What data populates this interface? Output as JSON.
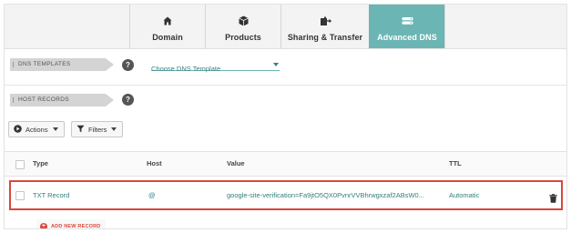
{
  "tabs": [
    {
      "label": "Domain",
      "icon": "home-icon"
    },
    {
      "label": "Products",
      "icon": "box-icon"
    },
    {
      "label": "Sharing & Transfer",
      "icon": "share-icon"
    },
    {
      "label": "Advanced DNS",
      "icon": "server-icon",
      "active": true
    }
  ],
  "dns_templates": {
    "section_label": "DNS TEMPLATES",
    "help": "?",
    "select_value": "Choose DNS Template"
  },
  "host_records": {
    "section_label": "HOST RECORDS",
    "help": "?"
  },
  "toolbar": {
    "actions_label": "Actions",
    "filters_label": "Filters"
  },
  "table": {
    "columns": [
      "Type",
      "Host",
      "Value",
      "TTL"
    ],
    "rows": [
      {
        "type": "TXT Record",
        "host": "@",
        "value": "google-site-verification=Fa9jtO5QX0PvnrVVBhrwgxzaf2ABsW0...",
        "ttl": "Automatic"
      }
    ]
  },
  "add_record_label": "ADD NEW RECORD",
  "colors": {
    "accent_teal": "#6bb5b4",
    "danger_red": "#d9473b"
  }
}
